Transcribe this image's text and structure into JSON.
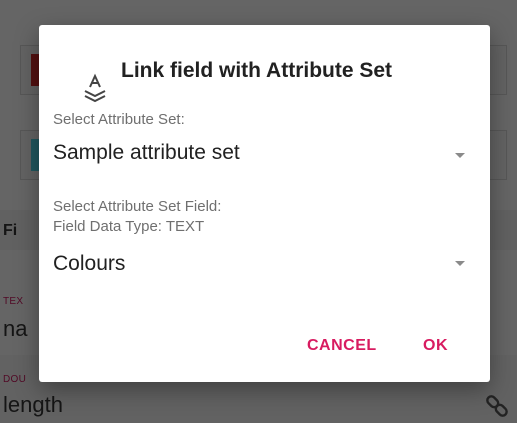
{
  "background": {
    "section_heading": "Fi",
    "field1_type": "TEX",
    "field1_value": "na",
    "field2_type": "DOU",
    "field2_value": "length",
    "link_icon": "link-icon"
  },
  "dialog": {
    "icon": "attribute-set-icon",
    "title": "Link field with Attribute Set",
    "attribute_set_label": "Select Attribute Set:",
    "attribute_set_value": "Sample attribute set",
    "field_label": "Select Attribute Set Field:",
    "field_type_label": "Field Data Type: TEXT",
    "field_value": "Colours",
    "cancel_label": "CANCEL",
    "ok_label": "OK"
  },
  "colors": {
    "accent": "#d81b60",
    "scrim": "#000000"
  }
}
